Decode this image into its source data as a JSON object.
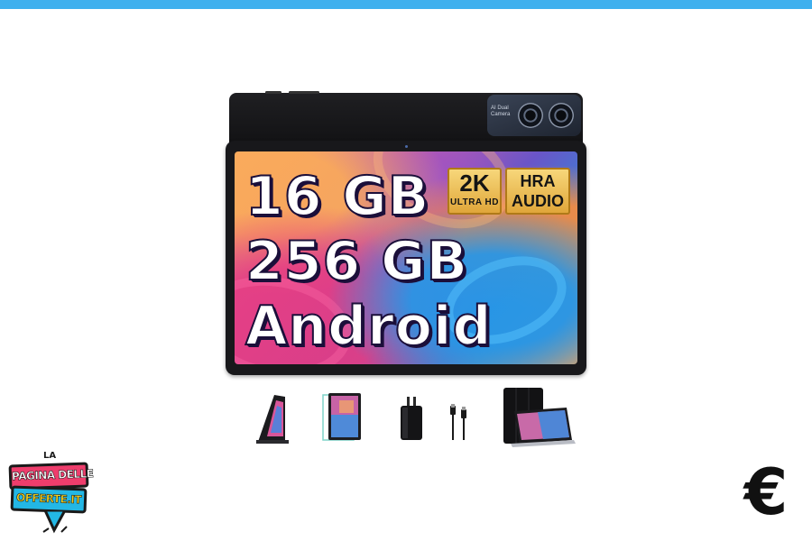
{
  "header": {
    "accent_color": "#3fb0ee"
  },
  "product_image": {
    "camera_label": "AI Dual Camera",
    "hero_lines": [
      "16 GB",
      "256 GB",
      "Android"
    ],
    "badges": {
      "resolution_main": "2K",
      "resolution_sub": "ULTRA HD",
      "audio_line1": "HRA",
      "audio_line2": "AUDIO"
    },
    "accessories": [
      {
        "icon": "tablet-stand-icon"
      },
      {
        "icon": "screen-protector-icon"
      },
      {
        "icon": "charger-icon"
      },
      {
        "icon": "usb-c-cable-icon"
      },
      {
        "icon": "folio-case-icon"
      }
    ]
  },
  "logo": {
    "top": "LA",
    "line1": "PAGINA DELLE",
    "line2": "OFFERTE.IT",
    "colors": {
      "primary": "#ee3d6c",
      "secondary": "#23b7e5",
      "text_accent": "#f7d21c"
    }
  },
  "currency_symbol": "€"
}
